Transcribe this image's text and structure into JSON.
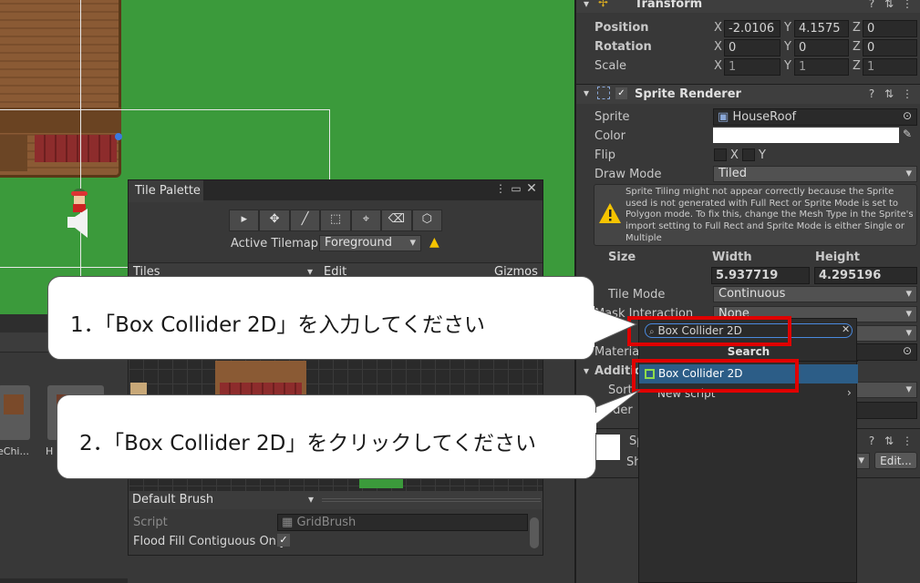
{
  "tile_palette": {
    "title": "Tile Palette",
    "tools": [
      "▸",
      "✥",
      "╱",
      "⬚",
      "⌖",
      "⌫",
      "⬡"
    ],
    "active_tilemap_label": "Active Tilemap",
    "active_tilemap_value": "Foreground",
    "tiles_label": "Tiles",
    "edit_label": "Edit",
    "gizmos_label": "Gizmos",
    "brush_value": "Default Brush",
    "script_label": "Script",
    "script_value": "GridBrush",
    "flood_fill_label": "Flood Fill Contiguous Only",
    "flood_fill_checked": "✓"
  },
  "project_assets": [
    {
      "label": "eChi..."
    },
    {
      "label": "H"
    }
  ],
  "inspector": {
    "transform": {
      "title": "Transform",
      "rows": [
        {
          "label": "Position",
          "x": "-2.0106",
          "y": "4.1575",
          "z": "0"
        },
        {
          "label": "Rotation",
          "x": "0",
          "y": "0",
          "z": "0"
        },
        {
          "label": "Scale",
          "x": "1",
          "y": "1",
          "z": "1"
        }
      ]
    },
    "sprite_renderer": {
      "title": "Sprite Renderer",
      "sprite_label": "Sprite",
      "sprite_value": "HouseRoof",
      "color_label": "Color",
      "flip_label": "Flip",
      "flip_x": "X",
      "flip_y": "Y",
      "draw_mode_label": "Draw Mode",
      "draw_mode_value": "Tiled",
      "warning_text": "Sprite Tiling might not appear correctly because the Sprite used is not generated with Full Rect or Sprite Mode is set to Polygon mode. To fix this, change the Mesh Type in the Sprite's import setting to Full Rect and Sprite Mode is either Single or Multiple",
      "size_label": "Size",
      "width_label": "Width",
      "height_label": "Height",
      "width_value": "5.937719",
      "height_value": "4.295196",
      "tile_mode_label": "Tile Mode",
      "tile_mode_value": "Continuous",
      "mask_interaction_label": "Mask Interaction",
      "mask_interaction_value": "None",
      "material_label": "Material",
      "additional_label": "Additio",
      "sorting_label": "Sorti",
      "order_label": "rder",
      "shadow_label": "Sp",
      "sh_label": "Sh",
      "edit_button": "Edit..."
    },
    "header_icons": {
      "help": "?",
      "settings": "⇅",
      "more": "⋮"
    }
  },
  "add_component_popup": {
    "search_value": "Box Collider 2D",
    "header": "Search",
    "result": "Box Collider 2D",
    "new_script": "New script"
  },
  "callouts": {
    "step1": "1．「Box Collider 2D」を入力してください",
    "step2": "2．「Box Collider 2D」をクリックしてください"
  },
  "colors": {
    "accent_red": "#e00000",
    "selection_blue": "#2c5d87",
    "warning_yellow": "#f5c400"
  }
}
